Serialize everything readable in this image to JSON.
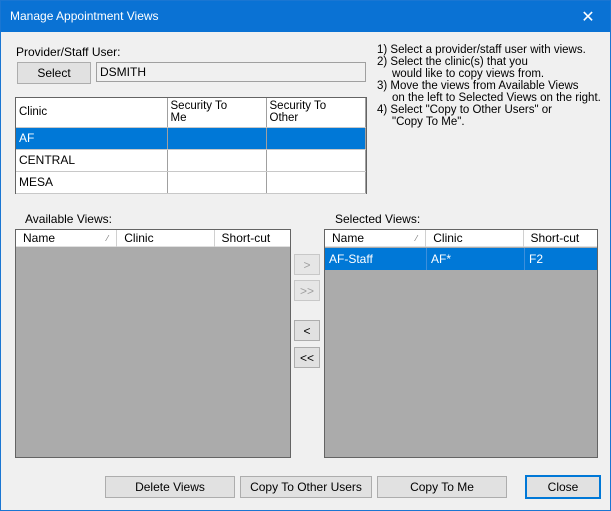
{
  "window": {
    "title": "Manage Appointment Views",
    "close_glyph": "✕"
  },
  "provider": {
    "label": "Provider/Staff User:",
    "select_button": "Select",
    "value": "DSMITH"
  },
  "instructions": [
    "1) Select a provider/staff user with views.",
    "2) Select the clinic(s) that you",
    "    would like to copy views from.",
    "3) Move the views from Available Views",
    "    on the left to Selected Views on the right.",
    "4) Select \"Copy to Other Users\" or",
    "    \"Copy To Me\"."
  ],
  "clinic_grid": {
    "headers": [
      "Clinic",
      "Security To\nMe",
      "Security To\nOther"
    ],
    "rows": [
      {
        "clinic": "AF",
        "sec_me": "",
        "sec_other": "",
        "selected": true
      },
      {
        "clinic": "CENTRAL",
        "sec_me": "",
        "sec_other": "",
        "selected": false
      },
      {
        "clinic": "MESA",
        "sec_me": "",
        "sec_other": "",
        "selected": false
      }
    ]
  },
  "available_views": {
    "label": "Available Views:",
    "columns": [
      "Name",
      "Clinic",
      "Short-cut"
    ],
    "sort_glyph": "⁄",
    "rows": []
  },
  "selected_views": {
    "label": "Selected Views:",
    "columns": [
      "Name",
      "Clinic",
      "Short-cut"
    ],
    "sort_glyph": "⁄",
    "rows": [
      {
        "name": "AF-Staff",
        "clinic": "AF*",
        "shortcut": "F2",
        "selected": true
      }
    ]
  },
  "move_buttons": {
    "move_one_right": ">",
    "move_all_right": ">>",
    "move_one_left": "<",
    "move_all_left": "<<"
  },
  "footer": {
    "delete_views": "Delete Views",
    "copy_to_other_users": "Copy To Other Users",
    "copy_to_me": "Copy To Me",
    "close": "Close"
  },
  "colors": {
    "title_bar": "#0a72d4",
    "selection": "#0078d7",
    "list_background": "#ababab"
  }
}
